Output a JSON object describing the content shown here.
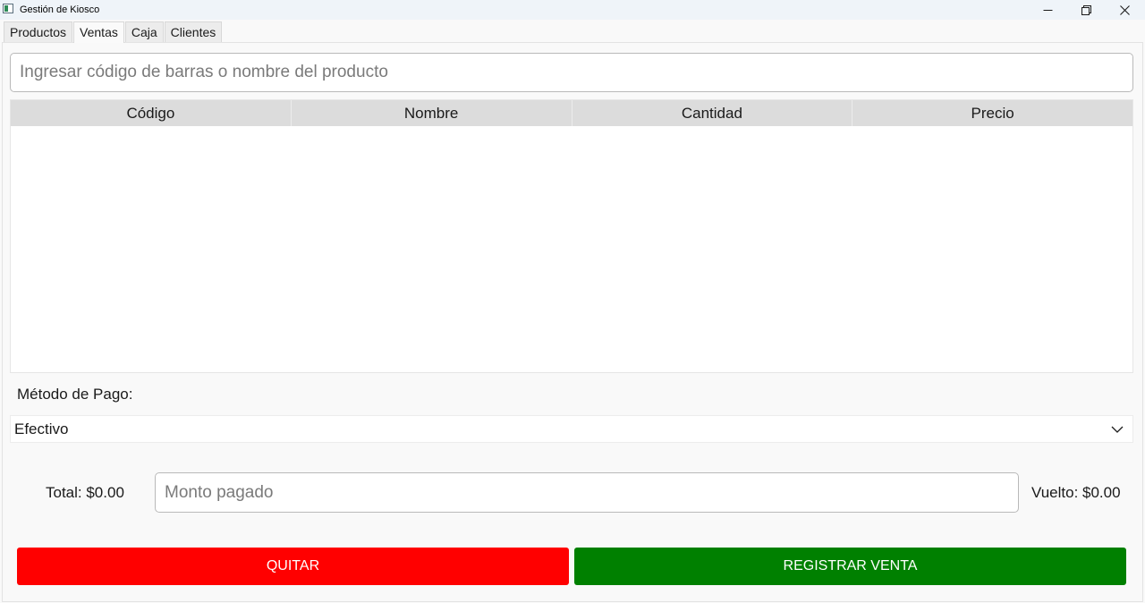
{
  "window": {
    "title": "Gestión de Kiosco"
  },
  "tabs": [
    {
      "label": "Productos",
      "active": false
    },
    {
      "label": "Ventas",
      "active": true
    },
    {
      "label": "Caja",
      "active": false
    },
    {
      "label": "Clientes",
      "active": false
    }
  ],
  "search": {
    "placeholder": "Ingresar código de barras o nombre del producto",
    "value": ""
  },
  "table": {
    "columns": [
      "Código",
      "Nombre",
      "Cantidad",
      "Precio"
    ],
    "rows": []
  },
  "payment": {
    "label": "Método de Pago:",
    "selected": "Efectivo"
  },
  "totals": {
    "total": "Total: $0.00",
    "paid_placeholder": "Monto pagado",
    "change": "Vuelto: $0.00"
  },
  "buttons": {
    "remove": "QUITAR",
    "register": "REGISTRAR VENTA"
  },
  "colors": {
    "remove_button": "#ff0000",
    "register_button": "#008000"
  },
  "icons": {
    "minimize": "minimize-icon",
    "restore": "restore-icon",
    "close": "close-icon",
    "dropdown": "chevron-down-icon"
  }
}
